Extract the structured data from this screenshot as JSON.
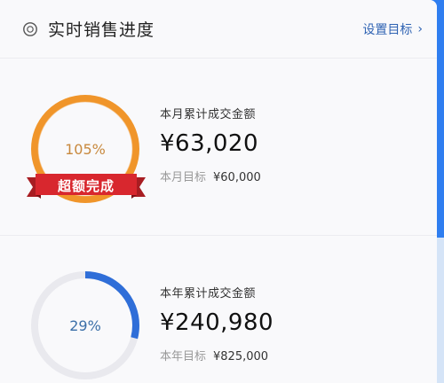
{
  "header": {
    "icon": "gauge-icon",
    "title": "实时销售进度",
    "link_label": "设置目标",
    "link_chevron": "›"
  },
  "monthly": {
    "percent_label": "105%",
    "progress": 1.05,
    "ribbon_label": "超额完成",
    "label": "本月累计成交金额",
    "amount": "¥63,020",
    "target_label": "本月目标",
    "target_value": "¥60,000",
    "ring_color": "#f0952a",
    "ribbon_color": "#d8272e"
  },
  "yearly": {
    "percent_label": "29%",
    "progress": 0.29,
    "label": "本年累计成交金额",
    "amount": "¥240,980",
    "target_label": "本年目标",
    "target_value": "¥825,000",
    "ring_color": "#2f6ed8",
    "track_color": "#e9e9ee"
  }
}
